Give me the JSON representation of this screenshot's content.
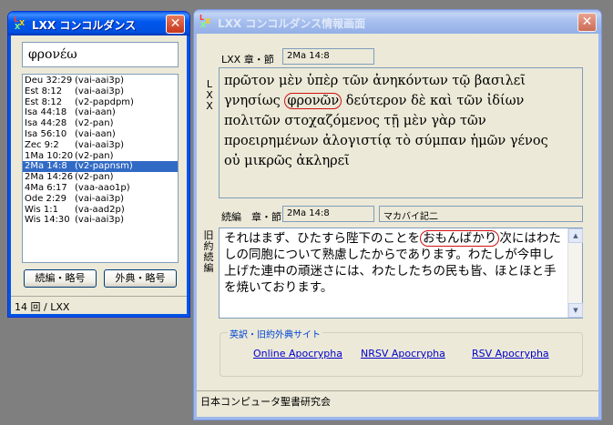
{
  "search_window": {
    "title": "LXX コンコルダンス",
    "search_value": "φρονέω",
    "verses": [
      {
        "ref": "Deu 32:29",
        "parse": "(vai-aai3p)"
      },
      {
        "ref": "Est 8:12",
        "parse": "(vai-aai3p)"
      },
      {
        "ref": "Est 8:12",
        "parse": "(v2-papdpm)"
      },
      {
        "ref": "Isa 44:18",
        "parse": "(vai-aan)"
      },
      {
        "ref": "Isa 44:28",
        "parse": "(v2-pan)"
      },
      {
        "ref": "Isa 56:10",
        "parse": "(vai-aan)"
      },
      {
        "ref": "Zec 9:2",
        "parse": "(vai-aai3p)"
      },
      {
        "ref": "1Ma 10:20",
        "parse": "(v2-pan)"
      },
      {
        "ref": "2Ma 14:8",
        "parse": "(v2-papnsm)"
      },
      {
        "ref": "2Ma 14:26",
        "parse": "(v2-pan)"
      },
      {
        "ref": "4Ma 6:17",
        "parse": "(vaa-aao1p)"
      },
      {
        "ref": "Ode 2:29",
        "parse": "(vai-aai3p)"
      },
      {
        "ref": "Wis 1:1",
        "parse": "(va-aad2p)"
      },
      {
        "ref": "Wis 14:30",
        "parse": "(vai-aai3p)"
      }
    ],
    "buttons": {
      "continuation": "続編・略号",
      "apocrypha": "外典・略号"
    },
    "status": "14 回 / LXX"
  },
  "info_window": {
    "title": "LXX コンコルダンス情報画面",
    "lxx_ref_label": "LXX 章・節",
    "lxx_ref_value": "2Ma 14:8",
    "lxx_side_label": [
      "L",
      "X",
      "X"
    ],
    "greek": {
      "l1": "πρῶτον μὲν ὑπὲρ τῶν ἀνηκόντων τῷ βασιλεῖ",
      "l2_pre": "γνησίως ",
      "l2_circled": "φρονῶν",
      "l2_post": " δεύτερον δὲ καὶ τῶν ἰδίων",
      "l3": "πολιτῶν στοχαζόμενος τῇ μὲν γὰρ τῶν",
      "l4": "προειρημένων ἀλογιστίᾳ τὸ σύμπαν ἡμῶν γένος",
      "l5": "οὐ μικρῶς ἀκληρεῖ"
    },
    "cont_label": "続編　章・節",
    "cont_ref_value": "2Ma 14:8",
    "cont_book_value": "マカバイ記二",
    "jp_side_label": [
      "旧",
      "約",
      "続",
      "編"
    ],
    "jp": {
      "pre": "それはまず、ひたすら陛下のことを",
      "circled": "おもんばかり",
      "post": "次にはわたしの同胞について熟慮したからであります。わたしが今申し上げた連中の頑迷さには、わたしたちの民も皆、ほとほと手を焼いております。"
    },
    "links_group_title": "英訳・旧約外典サイト",
    "links": {
      "online": "Online Apocrypha",
      "nrsv": "NRSV Apocrypha",
      "rsv": "RSV Apocrypha"
    },
    "status": "日本コンピュータ聖書研究会"
  }
}
